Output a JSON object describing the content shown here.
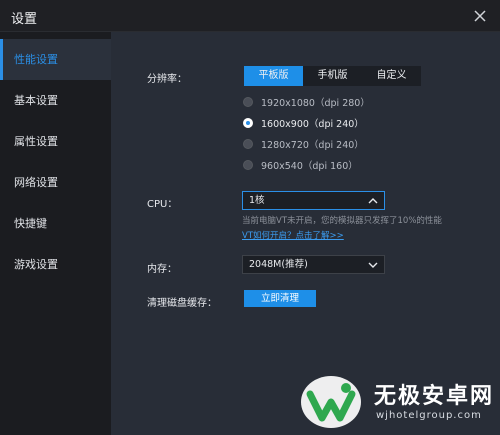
{
  "window": {
    "title": "设置"
  },
  "sidebar": {
    "items": [
      {
        "label": "性能设置",
        "active": true
      },
      {
        "label": "基本设置",
        "active": false
      },
      {
        "label": "属性设置",
        "active": false
      },
      {
        "label": "网络设置",
        "active": false
      },
      {
        "label": "快捷键",
        "active": false
      },
      {
        "label": "游戏设置",
        "active": false
      }
    ]
  },
  "resolution": {
    "label": "分辨率：",
    "modes": [
      "平板版",
      "手机版",
      "自定义"
    ],
    "selected_mode": "平板版",
    "options": [
      "1920x1080（dpi 280）",
      "1600x900（dpi 240）",
      "1280x720（dpi 240）",
      "960x540（dpi 160）"
    ],
    "selected_option": "1600x900（dpi 240）"
  },
  "cpu": {
    "label": "CPU：",
    "value": "1核",
    "hint": "当前电脑VT未开启，您的模拟器只发挥了10%的性能",
    "link": "VT如何开启？点击了解>>"
  },
  "memory": {
    "label": "内存：",
    "value": "2048M(推荐)"
  },
  "cache": {
    "label": "清理磁盘缓存：",
    "button": "立即清理"
  },
  "watermark": {
    "name": "无极安卓网",
    "url": "wjhotelgroup.com"
  },
  "colors": {
    "accent": "#1e8fe8",
    "sidebar_bg": "#1b1c20",
    "content_bg": "#282d37",
    "active_item_bg": "#2b313c"
  }
}
